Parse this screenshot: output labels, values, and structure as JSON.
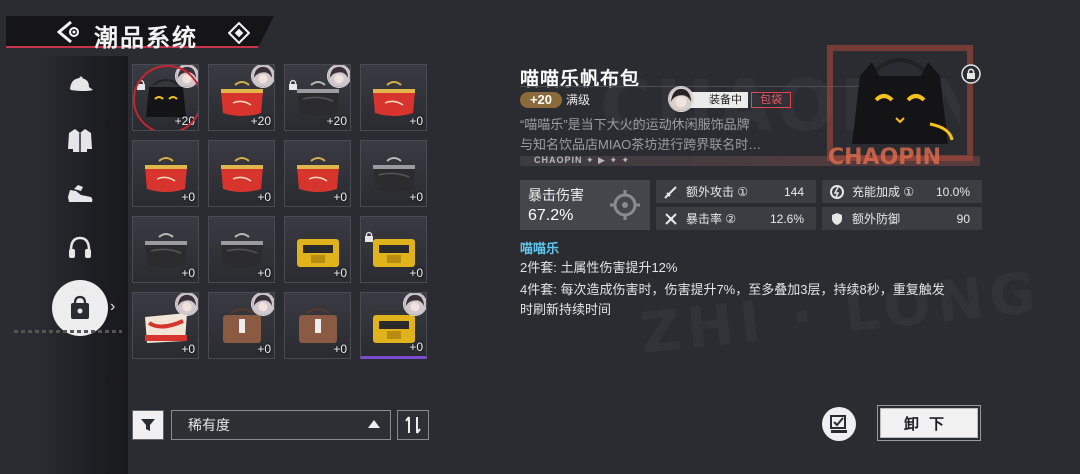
{
  "header": {
    "title": "潮品系统"
  },
  "sidebar": {
    "items": [
      {
        "icon": "cap-icon"
      },
      {
        "icon": "jacket-icon"
      },
      {
        "icon": "sneaker-icon"
      },
      {
        "icon": "headphones-icon"
      },
      {
        "icon": "bag-icon",
        "active": true
      }
    ]
  },
  "inventory": [
    {
      "item": "black-cat-bag",
      "level": "+20",
      "locked": true,
      "equipped_avatar": true,
      "selected": true
    },
    {
      "item": "red-clutch",
      "level": "+20",
      "equipped_avatar": true
    },
    {
      "item": "black-clutch",
      "level": "+20",
      "locked": true,
      "equipped_avatar": true
    },
    {
      "item": "red-clutch",
      "level": "+0"
    },
    {
      "item": "red-clutch",
      "level": "+0"
    },
    {
      "item": "red-clutch",
      "level": "+0"
    },
    {
      "item": "red-clutch",
      "level": "+0"
    },
    {
      "item": "black-clutch",
      "level": "+0"
    },
    {
      "item": "black-clutch",
      "level": "+0"
    },
    {
      "item": "black-clutch",
      "level": "+0"
    },
    {
      "item": "yellow-bag",
      "level": "+0"
    },
    {
      "item": "yellow-bag",
      "level": "+0",
      "locked": true
    },
    {
      "item": "red-pouch",
      "level": "+0",
      "equipped_avatar": true
    },
    {
      "item": "brown-bag",
      "level": "+0",
      "equipped_avatar": true
    },
    {
      "item": "brown-bag",
      "level": "+0"
    },
    {
      "item": "yellow-bag",
      "level": "+0",
      "equipped_avatar": true,
      "purple": true
    }
  ],
  "filter": {
    "sort_label": "稀有度"
  },
  "detail": {
    "name": "喵喵乐帆布包",
    "level": "+20",
    "level_status": "满级",
    "equip_status": "装备中",
    "type_tag": "包袋",
    "desc_line1": "“喵喵乐”是当下大火的运动休闲服饰品牌",
    "desc_line2": "与知名饮品店MIAO茶坊进行跨界联名时…",
    "strip_text": "CHAOPIN ✦ ▶ ✦ ✦",
    "main_stat": {
      "name": "暴击伤害",
      "value": "67.2%"
    },
    "sub_stats": [
      {
        "name": "额外攻击 ①",
        "value": "144"
      },
      {
        "name": "充能加成 ①",
        "value": "10.0%"
      },
      {
        "name": "暴击率 ②",
        "value": "12.6%"
      },
      {
        "name": "额外防御",
        "value": "90"
      }
    ],
    "set_name": "喵喵乐",
    "set_2pc": "2件套: 土属性伤害提升12%",
    "set_4pc_a": "4件套: 每次造成伤害时，伤害提升7%，至多叠加3层，持续8秒，重复触发",
    "set_4pc_b": "时刷新持续时间"
  },
  "actions": {
    "unequip": "卸下"
  },
  "colors": {
    "accent_red": "#c8324a",
    "set_blue": "#5fc7ef",
    "gold": "#8a6a3a"
  }
}
